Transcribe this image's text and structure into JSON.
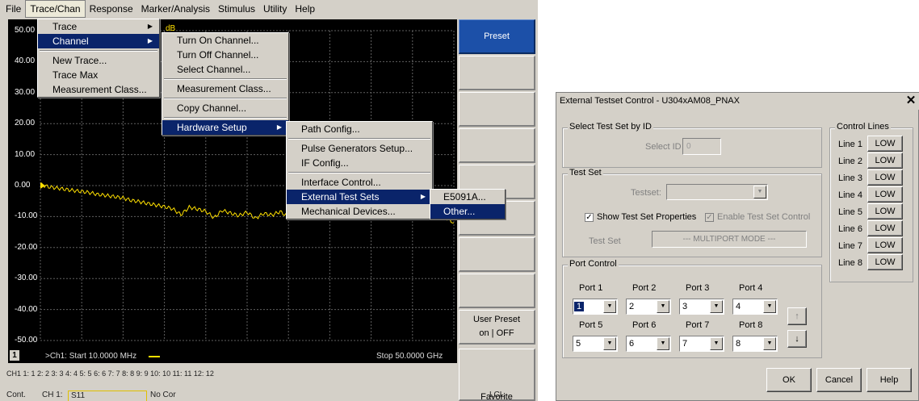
{
  "menubar": {
    "items": [
      "File",
      "Trace/Chan",
      "Response",
      "Marker/Analysis",
      "Stimulus",
      "Utility",
      "Help"
    ],
    "active": "Trace/Chan"
  },
  "trace_menu": {
    "items": [
      "Trace",
      "Channel",
      "New Trace...",
      "Trace Max",
      "Measurement Class..."
    ]
  },
  "channel_menu": {
    "items": [
      "Turn On Channel...",
      "Turn Off Channel...",
      "Select Channel...",
      "Measurement Class...",
      "Copy Channel...",
      "Hardware Setup"
    ]
  },
  "hardware_menu": {
    "items": [
      "Path Config...",
      "Pulse Generators Setup...",
      "IF Config...",
      "Interface Control...",
      "External Test Sets",
      "Mechanical Devices..."
    ]
  },
  "testsets_menu": {
    "items": [
      "E5091A...",
      "Other..."
    ]
  },
  "chart_data": {
    "type": "line",
    "yticks": [
      "50.00",
      "40.00",
      "30.00",
      "20.00",
      "10.00",
      "0.00",
      "-10.00",
      "-20.00",
      "-30.00",
      "-40.00",
      "-50.00"
    ],
    "ylim": [
      -50,
      50
    ],
    "top_unit": "dB",
    "trace_color": "#ffe000",
    "channel_number": "1",
    "start_label": ">Ch1: Start  10.0000 MHz",
    "stop_label": "Stop  50.0000 GHz",
    "x_range_ghz": [
      0.01,
      50
    ],
    "series": [
      {
        "x": [
          0.01,
          1,
          2,
          3,
          4,
          5,
          6,
          7,
          8,
          9,
          10,
          11,
          12,
          13,
          14,
          15,
          16,
          17,
          18,
          19,
          20,
          21,
          22,
          23,
          24,
          25,
          26,
          27,
          28,
          29,
          30,
          31,
          32,
          33,
          34,
          35,
          36,
          37,
          38,
          39,
          40,
          41,
          42,
          43,
          44,
          45,
          46,
          47,
          48,
          49,
          50
        ],
        "y": [
          0.3,
          -0.4,
          -0.8,
          -1.2,
          -1.6,
          -1.9,
          -2.3,
          -2.9,
          -3.2,
          -3.6,
          -4.0,
          -4.8,
          -5.2,
          -5.8,
          -6.3,
          -6.8,
          -7.5,
          -9.4,
          -7.0,
          -7.6,
          -8.3,
          -10.4,
          -8.0,
          -8.9,
          -9.7,
          -8.6,
          -10.6,
          -9.0,
          -9.5,
          -8.4,
          -10.2,
          -9.8,
          -9.0,
          -8.6,
          -9.5,
          -8.8,
          -7.9,
          -8.5,
          -9.3,
          -8.2,
          -7.6,
          -8.9,
          -9.4,
          -8.3,
          -9.0,
          -8.7,
          -9.5,
          -8.1,
          -9.2,
          -10.3,
          -12.0
        ]
      }
    ]
  },
  "softkeys": [
    "Preset",
    "",
    "",
    "",
    "",
    "",
    "",
    "",
    "User Preset",
    "on | OFF",
    "Favorite"
  ],
  "channel_tabs": "CH1 1: 1 2: 2 3: 3 4: 4 5: 5 6: 6 7: 7 8: 8 9: 9 10: 10 11: 11 12: 12",
  "status": {
    "mode": "Cont.",
    "channel": "CH 1:",
    "param": "S11",
    "correction": "No Cor",
    "remote": "LCL"
  },
  "dialog": {
    "title": "External Testset Control - U304xAM08_PNAX",
    "select_group": "Select Test Set by ID",
    "select_id_label": "Select ID",
    "select_id_value": "0",
    "testset_group": "Test Set",
    "testset_label": "Testset:",
    "show_props_label": "Show Test Set Properties",
    "enable_control_label": "Enable Test Set Control",
    "testset_field_label": "Test Set",
    "testset_mode": "--- MULTIPORT MODE ---",
    "port_group": "Port Control",
    "ports": [
      {
        "label": "Port 1",
        "value": "1"
      },
      {
        "label": "Port 2",
        "value": "2"
      },
      {
        "label": "Port 3",
        "value": "3"
      },
      {
        "label": "Port 4",
        "value": "4"
      },
      {
        "label": "Port 5",
        "value": "5"
      },
      {
        "label": "Port 6",
        "value": "6"
      },
      {
        "label": "Port 7",
        "value": "7"
      },
      {
        "label": "Port 8",
        "value": "8"
      }
    ],
    "control_lines_group": "Control Lines",
    "lines": [
      {
        "label": "Line 1",
        "value": "LOW"
      },
      {
        "label": "Line 2",
        "value": "LOW"
      },
      {
        "label": "Line 3",
        "value": "LOW"
      },
      {
        "label": "Line 4",
        "value": "LOW"
      },
      {
        "label": "Line 5",
        "value": "LOW"
      },
      {
        "label": "Line 6",
        "value": "LOW"
      },
      {
        "label": "Line 7",
        "value": "LOW"
      },
      {
        "label": "Line 8",
        "value": "LOW"
      }
    ],
    "ok": "OK",
    "cancel": "Cancel",
    "help": "Help"
  }
}
